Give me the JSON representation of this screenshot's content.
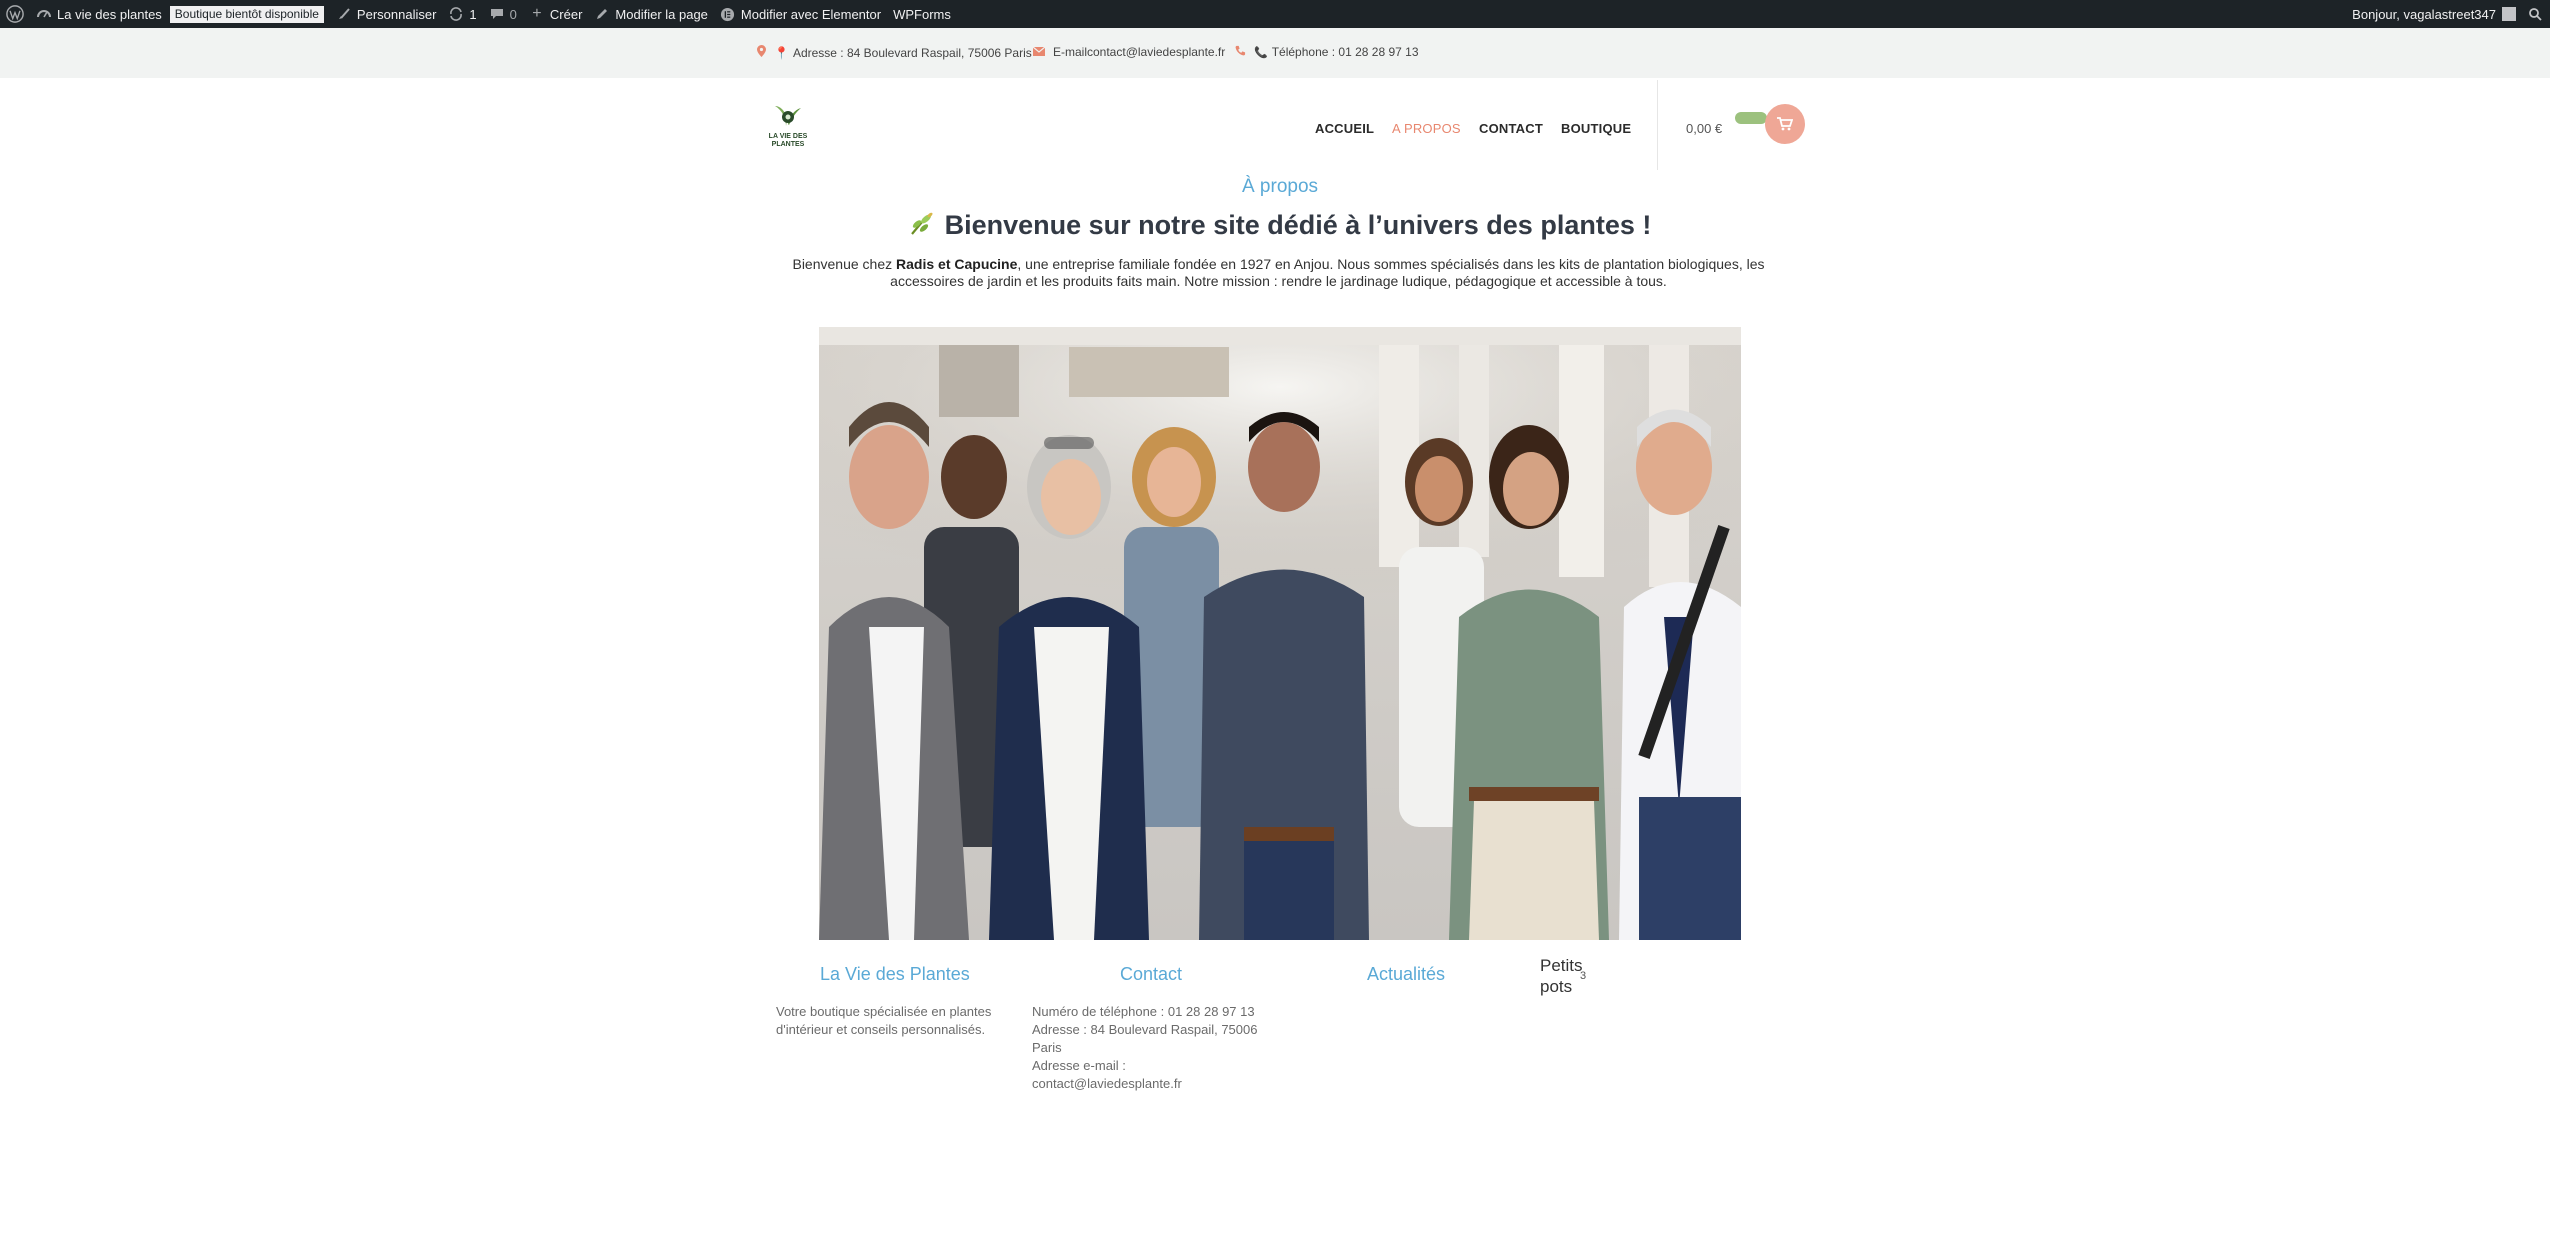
{
  "adminbar": {
    "site_name": "La vie des plantes",
    "badge": "Boutique bientôt disponible",
    "customize": "Personnaliser",
    "revisions_count": "1",
    "comments_count": "0",
    "create": "Créer",
    "edit_page": "Modifier la page",
    "edit_elementor": "Modifier avec Elementor",
    "wpforms": "WPForms",
    "greeting": "Bonjour, vagalastreet347"
  },
  "topbar": {
    "address": "Adresse : 84 Boulevard Raspail, 75006 Paris",
    "email": "E-mailcontact@laviedesplante.fr",
    "phone": "Téléphone : 01 28 28 97 13"
  },
  "header": {
    "logo_line1": "LA VIE DES",
    "logo_line2": "PLANTES",
    "nav": [
      "ACCUEIL",
      "A PROPOS",
      "CONTACT",
      "BOUTIQUE"
    ],
    "active_nav": "A PROPOS",
    "cart_total": "0,00 €"
  },
  "content": {
    "page_heading": "À propos",
    "title": "Bienvenue sur notre site dédié à l’univers des plantes !",
    "intro_before": "Bienvenue chez ",
    "intro_bold": "Radis et Capucine",
    "intro_after": ", une entreprise familiale fondée en 1927 en Anjou. Nous sommes spécialisés dans les kits de plantation biologiques, les accessoires de jardin et les produits faits main. Notre mission : rendre le jardinage ludique, pédagogique et accessible à tous."
  },
  "footer": {
    "col1_title": "La Vie des Plantes",
    "col1_text": "Votre boutique spécialisée en plantes d'intérieur et conseils personnalisés.",
    "col2_title": "Contact",
    "col2_phone": "Numéro de téléphone : 01 28 28 97 13",
    "col2_address": "Adresse : 84 Boulevard Raspail, 75006 Paris",
    "col2_email_label": "Adresse e-mail :",
    "col2_email": "contact@laviedesplante.fr",
    "col3_title": "Actualités",
    "col4_line1": "Petits",
    "col4_line2": "pots",
    "col4_sup": "3"
  },
  "colors": {
    "accent_blue": "#5aa9d6",
    "accent_salmon": "#e8876f",
    "admin_bar": "#1d2327"
  }
}
